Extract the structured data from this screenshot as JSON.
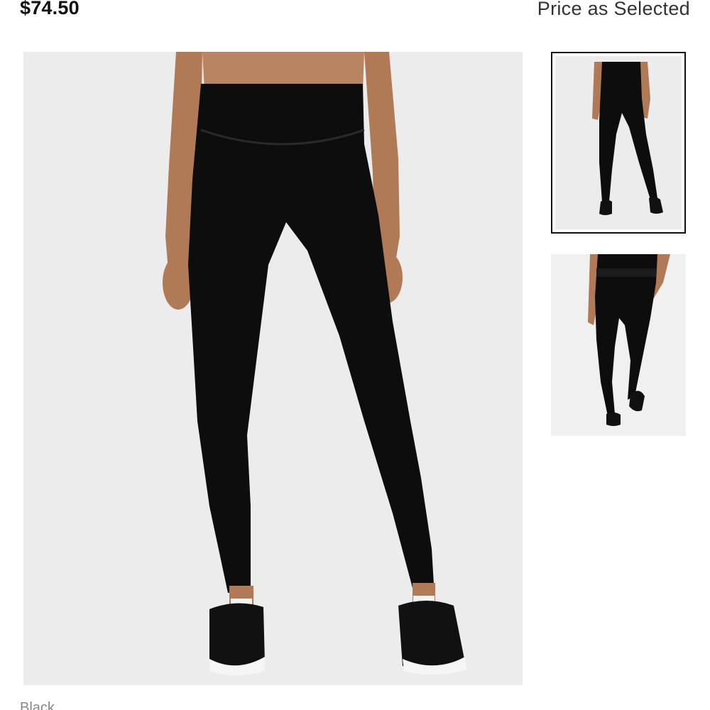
{
  "product": {
    "price": "$74.50",
    "price_note": "Price as Selected",
    "color_label": "Black"
  },
  "gallery": {
    "main_image": "leggings-front-view",
    "thumbnails": [
      {
        "image": "leggings-front-full-body",
        "selected": true
      },
      {
        "image": "leggings-back-view",
        "selected": false
      }
    ]
  },
  "colors": {
    "image_background": "#ececec",
    "garment": "#0d0d0d",
    "skin": "#b07a56",
    "selected_border": "#111111"
  }
}
